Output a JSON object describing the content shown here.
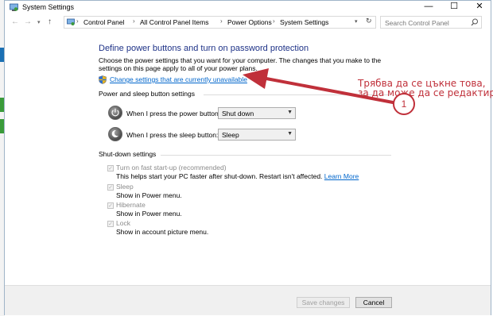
{
  "window": {
    "title": "System Settings",
    "minimize": "—",
    "maximize": "☐",
    "close": "✕"
  },
  "nav": {
    "back_icon": "left-arrow",
    "forward_icon": "right-arrow",
    "up_icon": "up-arrow",
    "breadcrumb": [
      "Control Panel",
      "All Control Panel Items",
      "Power Options",
      "System Settings"
    ],
    "search_placeholder": "Search Control Panel"
  },
  "main": {
    "heading": "Define power buttons and turn on password protection",
    "description": "Choose the power settings that you want for your computer. The changes that you make to the settings on this page apply to all of your power plans.",
    "change_link": "Change settings that are currently unavailable"
  },
  "power_group": {
    "title": "Power and sleep button settings",
    "power_label": "When I press the power button:",
    "power_value": "Shut down",
    "sleep_label": "When I press the sleep button:",
    "sleep_value": "Sleep"
  },
  "shutdown_group": {
    "title": "Shut-down settings",
    "items": [
      {
        "label": "Turn on fast start-up (recommended)",
        "desc": "This helps start your PC faster after shut-down. Restart isn't affected.",
        "link": "Learn More"
      },
      {
        "label": "Sleep",
        "desc": "Show in Power menu."
      },
      {
        "label": "Hibernate",
        "desc": "Show in Power menu."
      },
      {
        "label": "Lock",
        "desc": "Show in account picture menu."
      }
    ]
  },
  "footer": {
    "save": "Save changes",
    "cancel": "Cancel"
  },
  "annotation": {
    "line1": "Трябва да се цъкне това,",
    "line2": "за да може да се редактира",
    "number": "1",
    "color": "#c0303a"
  }
}
